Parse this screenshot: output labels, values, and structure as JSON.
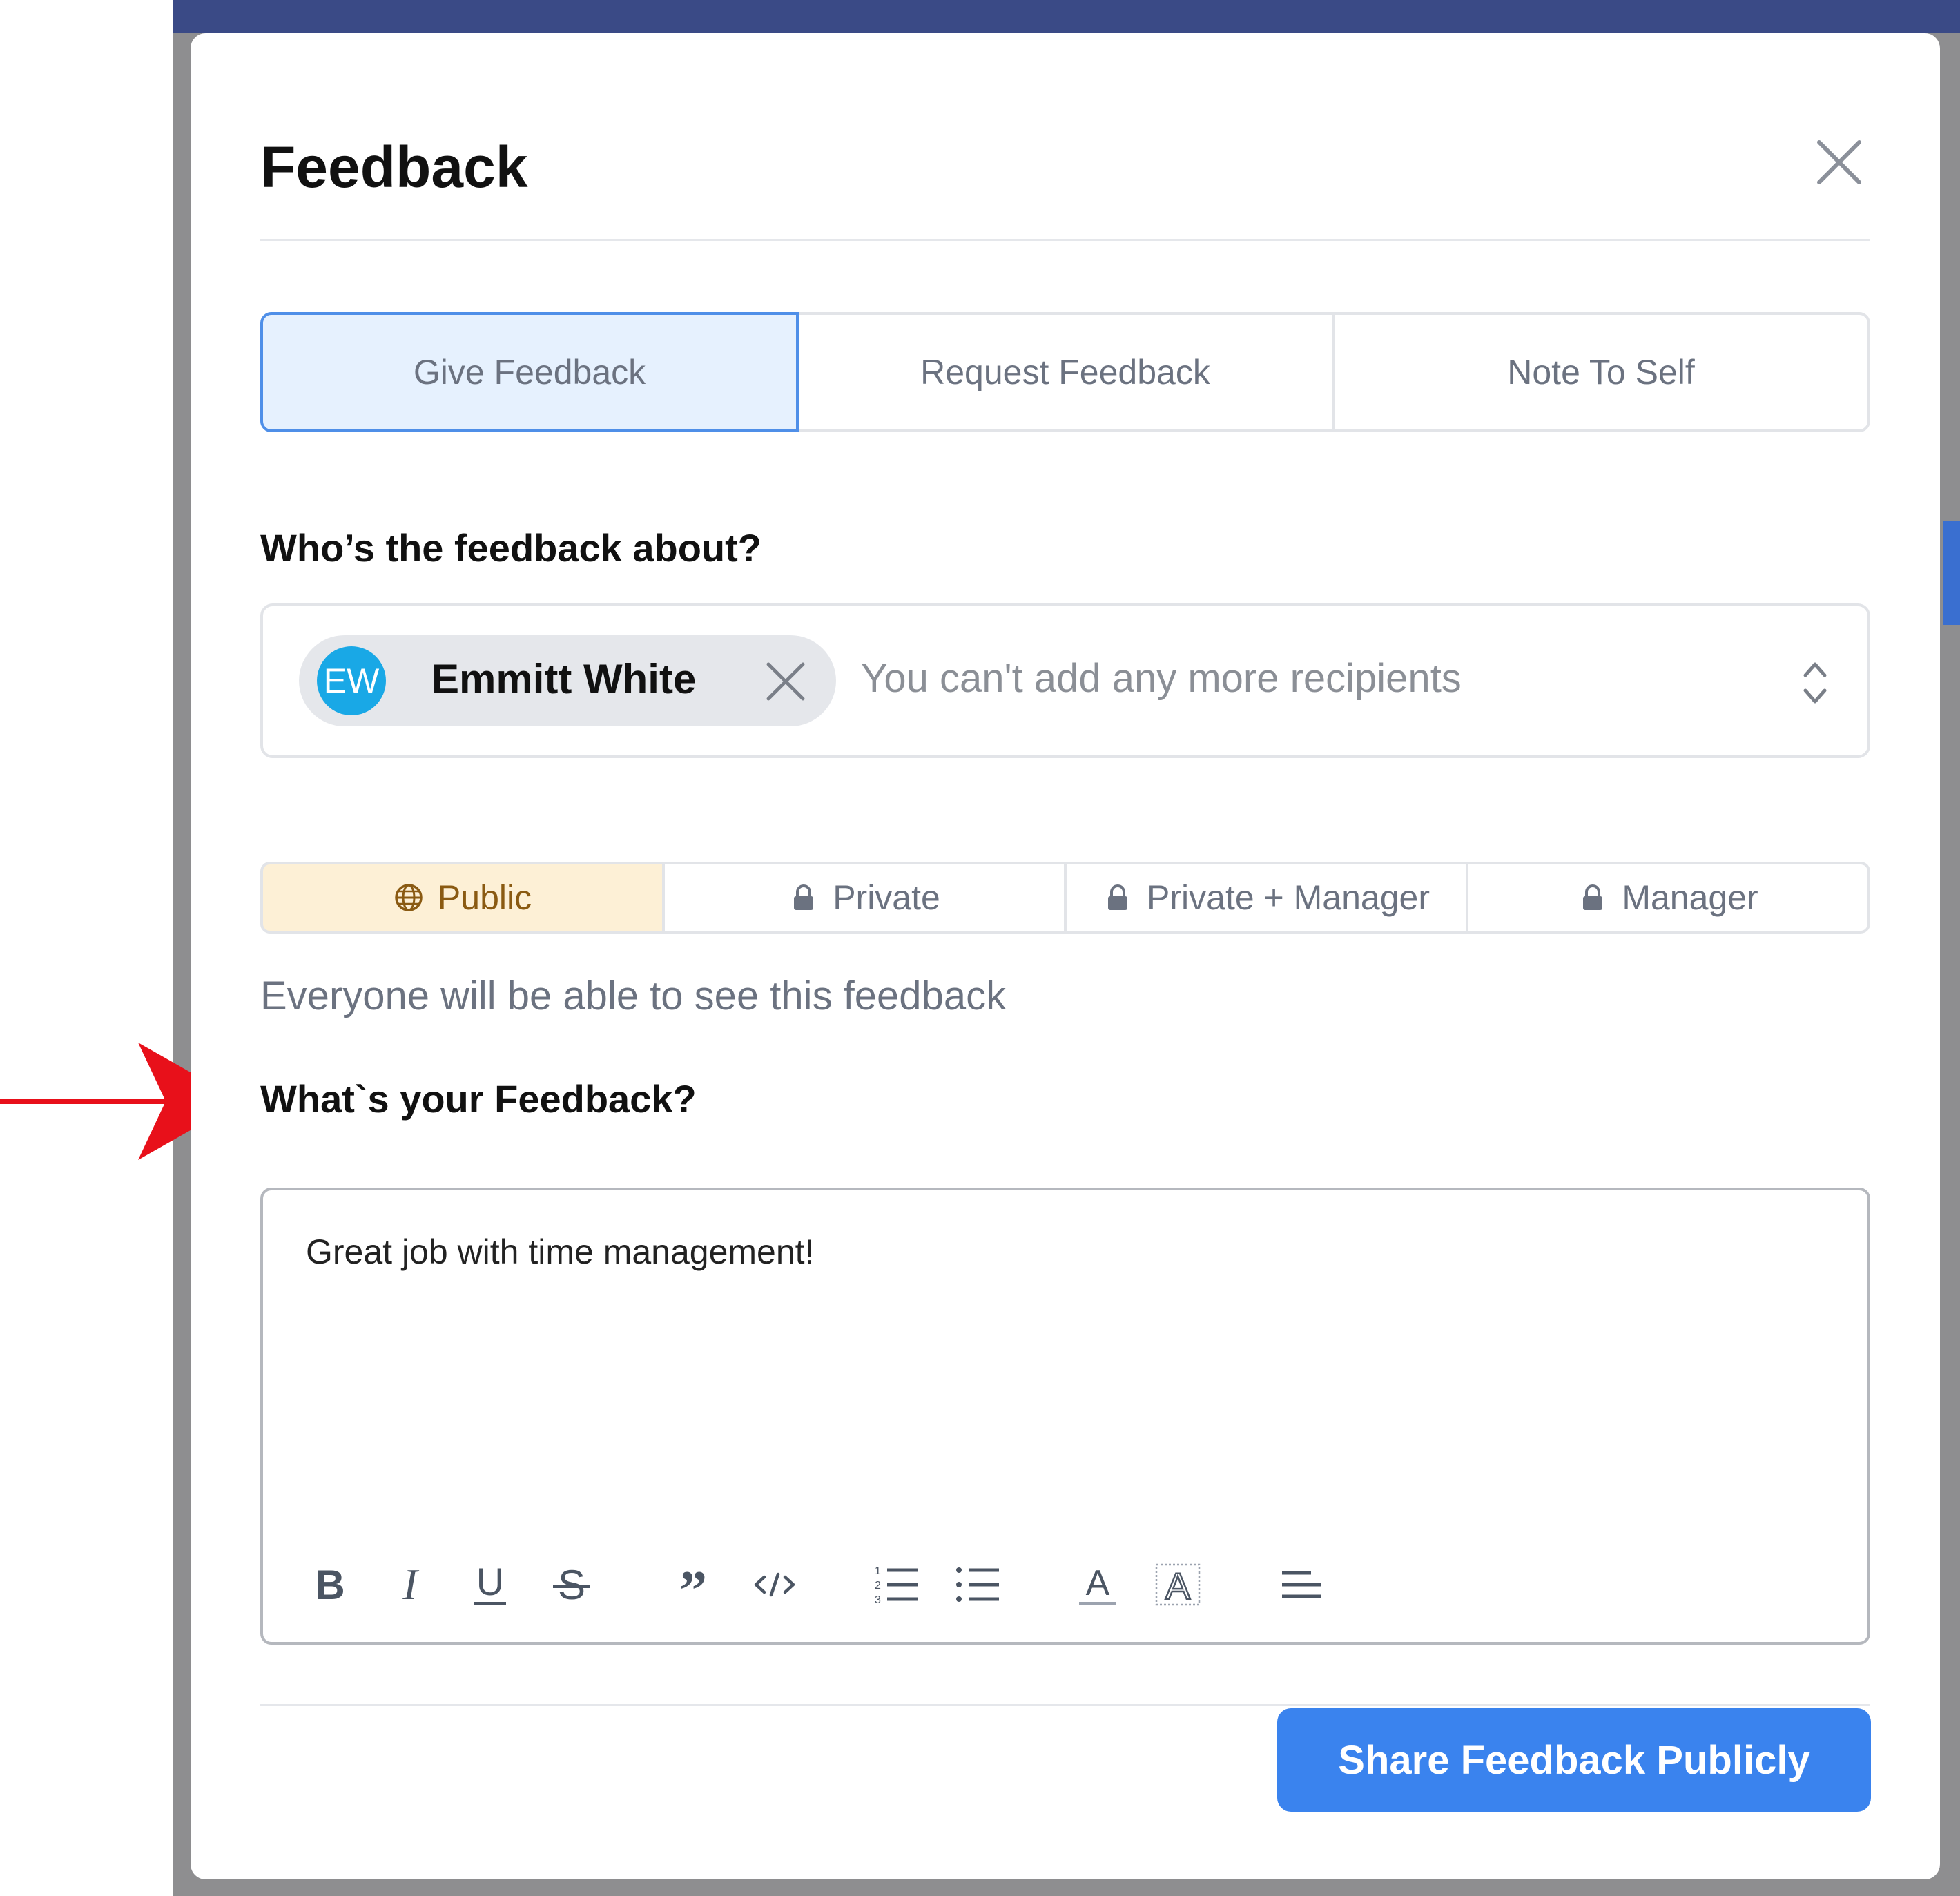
{
  "modal": {
    "title": "Feedback",
    "tabs": [
      {
        "label": "Give Feedback",
        "active": true
      },
      {
        "label": "Request Feedback",
        "active": false
      },
      {
        "label": "Note To Self",
        "active": false
      }
    ]
  },
  "recipient": {
    "section_label": "Who’s the feedback about?",
    "chip": {
      "initials": "EW",
      "name": "Emmitt White",
      "avatar_color": "#19a8e6"
    },
    "placeholder": "You can't add any more recipients"
  },
  "privacy": {
    "options": [
      {
        "label": "Public",
        "icon": "globe-icon",
        "active": true
      },
      {
        "label": "Private",
        "icon": "lock-icon",
        "active": false
      },
      {
        "label": "Private + Manager",
        "icon": "lock-icon",
        "active": false
      },
      {
        "label": "Manager",
        "icon": "lock-icon",
        "active": false
      }
    ],
    "description": "Everyone will be able to see this feedback"
  },
  "feedback": {
    "section_label": "What`s your Feedback?",
    "text": "Great job with time management!"
  },
  "toolbar": {
    "buttons": [
      "bold-icon",
      "italic-icon",
      "underline-icon",
      "strikethrough-icon",
      "blockquote-icon",
      "code-icon",
      "ordered-list-icon",
      "bullet-list-icon",
      "text-color-icon",
      "highlight-icon",
      "align-icon"
    ]
  },
  "footer": {
    "submit_label": "Share Feedback Publicly"
  },
  "colors": {
    "accent": "#3a83ee",
    "active_tab_bg": "#e6f1fe",
    "public_bg": "#fdf0d6",
    "annotation_arrow": "#e8101a"
  }
}
